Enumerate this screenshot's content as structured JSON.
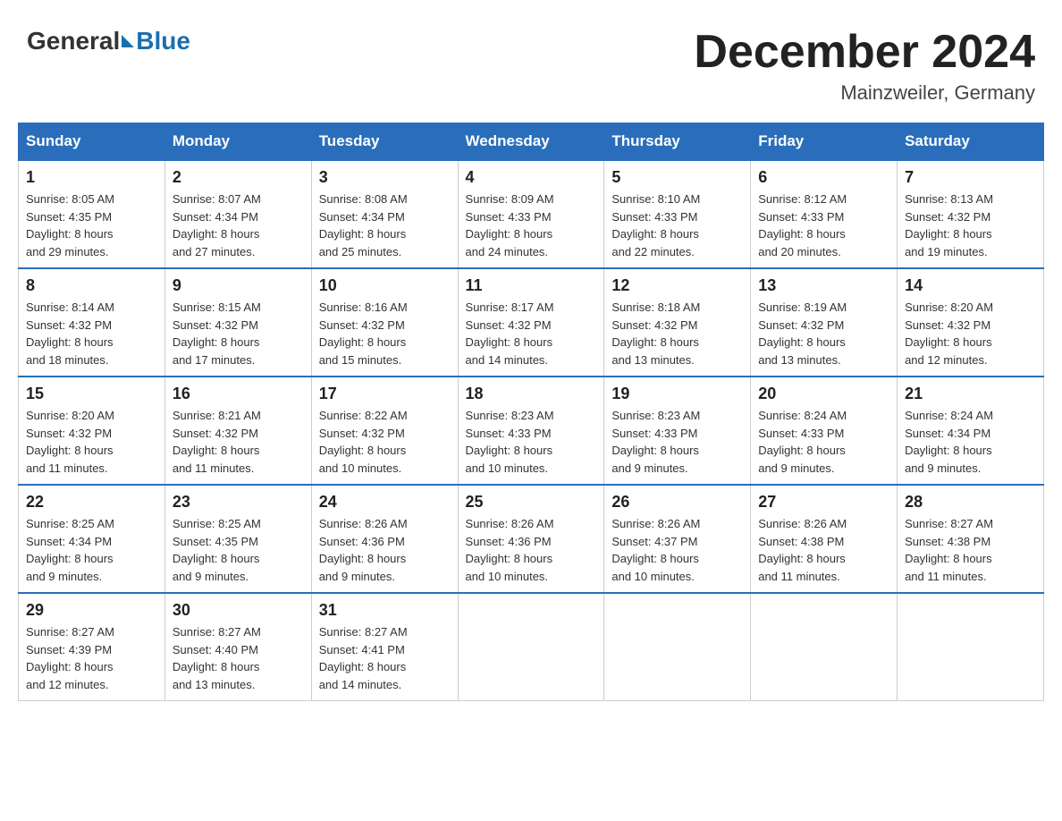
{
  "header": {
    "logo_general": "General",
    "logo_blue": "Blue",
    "month_title": "December 2024",
    "location": "Mainzweiler, Germany"
  },
  "weekdays": [
    "Sunday",
    "Monday",
    "Tuesday",
    "Wednesday",
    "Thursday",
    "Friday",
    "Saturday"
  ],
  "weeks": [
    [
      {
        "day": "1",
        "sunrise": "8:05 AM",
        "sunset": "4:35 PM",
        "daylight": "8 hours and 29 minutes."
      },
      {
        "day": "2",
        "sunrise": "8:07 AM",
        "sunset": "4:34 PM",
        "daylight": "8 hours and 27 minutes."
      },
      {
        "day": "3",
        "sunrise": "8:08 AM",
        "sunset": "4:34 PM",
        "daylight": "8 hours and 25 minutes."
      },
      {
        "day": "4",
        "sunrise": "8:09 AM",
        "sunset": "4:33 PM",
        "daylight": "8 hours and 24 minutes."
      },
      {
        "day": "5",
        "sunrise": "8:10 AM",
        "sunset": "4:33 PM",
        "daylight": "8 hours and 22 minutes."
      },
      {
        "day": "6",
        "sunrise": "8:12 AM",
        "sunset": "4:33 PM",
        "daylight": "8 hours and 20 minutes."
      },
      {
        "day": "7",
        "sunrise": "8:13 AM",
        "sunset": "4:32 PM",
        "daylight": "8 hours and 19 minutes."
      }
    ],
    [
      {
        "day": "8",
        "sunrise": "8:14 AM",
        "sunset": "4:32 PM",
        "daylight": "8 hours and 18 minutes."
      },
      {
        "day": "9",
        "sunrise": "8:15 AM",
        "sunset": "4:32 PM",
        "daylight": "8 hours and 17 minutes."
      },
      {
        "day": "10",
        "sunrise": "8:16 AM",
        "sunset": "4:32 PM",
        "daylight": "8 hours and 15 minutes."
      },
      {
        "day": "11",
        "sunrise": "8:17 AM",
        "sunset": "4:32 PM",
        "daylight": "8 hours and 14 minutes."
      },
      {
        "day": "12",
        "sunrise": "8:18 AM",
        "sunset": "4:32 PM",
        "daylight": "8 hours and 13 minutes."
      },
      {
        "day": "13",
        "sunrise": "8:19 AM",
        "sunset": "4:32 PM",
        "daylight": "8 hours and 13 minutes."
      },
      {
        "day": "14",
        "sunrise": "8:20 AM",
        "sunset": "4:32 PM",
        "daylight": "8 hours and 12 minutes."
      }
    ],
    [
      {
        "day": "15",
        "sunrise": "8:20 AM",
        "sunset": "4:32 PM",
        "daylight": "8 hours and 11 minutes."
      },
      {
        "day": "16",
        "sunrise": "8:21 AM",
        "sunset": "4:32 PM",
        "daylight": "8 hours and 11 minutes."
      },
      {
        "day": "17",
        "sunrise": "8:22 AM",
        "sunset": "4:32 PM",
        "daylight": "8 hours and 10 minutes."
      },
      {
        "day": "18",
        "sunrise": "8:23 AM",
        "sunset": "4:33 PM",
        "daylight": "8 hours and 10 minutes."
      },
      {
        "day": "19",
        "sunrise": "8:23 AM",
        "sunset": "4:33 PM",
        "daylight": "8 hours and 9 minutes."
      },
      {
        "day": "20",
        "sunrise": "8:24 AM",
        "sunset": "4:33 PM",
        "daylight": "8 hours and 9 minutes."
      },
      {
        "day": "21",
        "sunrise": "8:24 AM",
        "sunset": "4:34 PM",
        "daylight": "8 hours and 9 minutes."
      }
    ],
    [
      {
        "day": "22",
        "sunrise": "8:25 AM",
        "sunset": "4:34 PM",
        "daylight": "8 hours and 9 minutes."
      },
      {
        "day": "23",
        "sunrise": "8:25 AM",
        "sunset": "4:35 PM",
        "daylight": "8 hours and 9 minutes."
      },
      {
        "day": "24",
        "sunrise": "8:26 AM",
        "sunset": "4:36 PM",
        "daylight": "8 hours and 9 minutes."
      },
      {
        "day": "25",
        "sunrise": "8:26 AM",
        "sunset": "4:36 PM",
        "daylight": "8 hours and 10 minutes."
      },
      {
        "day": "26",
        "sunrise": "8:26 AM",
        "sunset": "4:37 PM",
        "daylight": "8 hours and 10 minutes."
      },
      {
        "day": "27",
        "sunrise": "8:26 AM",
        "sunset": "4:38 PM",
        "daylight": "8 hours and 11 minutes."
      },
      {
        "day": "28",
        "sunrise": "8:27 AM",
        "sunset": "4:38 PM",
        "daylight": "8 hours and 11 minutes."
      }
    ],
    [
      {
        "day": "29",
        "sunrise": "8:27 AM",
        "sunset": "4:39 PM",
        "daylight": "8 hours and 12 minutes."
      },
      {
        "day": "30",
        "sunrise": "8:27 AM",
        "sunset": "4:40 PM",
        "daylight": "8 hours and 13 minutes."
      },
      {
        "day": "31",
        "sunrise": "8:27 AM",
        "sunset": "4:41 PM",
        "daylight": "8 hours and 14 minutes."
      },
      null,
      null,
      null,
      null
    ]
  ],
  "labels": {
    "sunrise": "Sunrise:",
    "sunset": "Sunset:",
    "daylight": "Daylight:"
  }
}
